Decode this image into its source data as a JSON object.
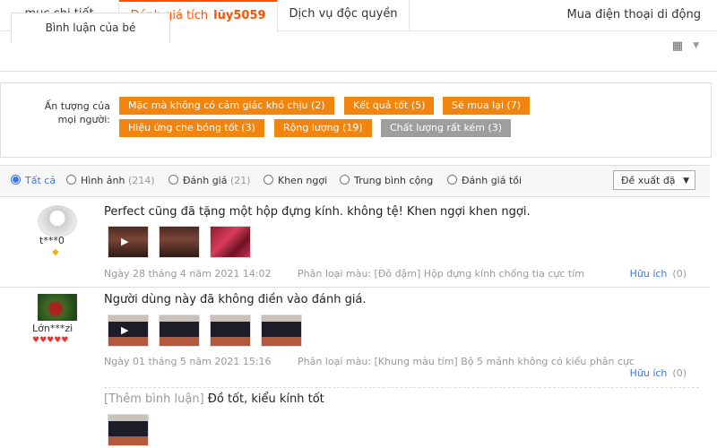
{
  "topbar": {
    "tabs": [
      {
        "label": "mục chi tiết"
      },
      {
        "label": "Đánh giá tích",
        "strong": "lũy5059"
      },
      {
        "label": "Dịch vụ độc quyền"
      }
    ],
    "right_link": "Mua điện thoại di động"
  },
  "subtab": {
    "label": "Bình luận của bé"
  },
  "impressions": {
    "label_line1": "Ấn tượng của",
    "label_line2": "mọi người:",
    "tags": [
      {
        "label": "Mặc mà không có cảm giác khó chịu (2)"
      },
      {
        "label": "Kết quả tốt (5)"
      },
      {
        "label": "Sẽ mua lại (7)"
      },
      {
        "label": "Hiệu ứng che bóng tốt (3)"
      },
      {
        "label": "Rộng lượng (19)"
      },
      {
        "label": "Chất lượng rất kém (3)"
      }
    ]
  },
  "filters": {
    "options": [
      {
        "label": "Tất cả",
        "count": "",
        "selected": true
      },
      {
        "label": "Hình ảnh",
        "count": "(214)"
      },
      {
        "label": "Đánh giá",
        "count": "(21)"
      },
      {
        "label": "Khen ngợi",
        "count": ""
      },
      {
        "label": "Trung bình cộng",
        "count": ""
      },
      {
        "label": "Đánh giá tồi",
        "count": ""
      }
    ],
    "sort_label": "Đề xuất đặ"
  },
  "reviews": [
    {
      "user": "t***0",
      "content": "Perfect cũng đã tặng một hộp đựng kính. không tệ! Khen ngợi khen ngợi.",
      "date": "Ngày 28 tháng 4 năm 2021 14:02",
      "variant": "Phân loại màu: [Đô đậm] Hộp đựng kính chống tia cực tím",
      "useful_label": "Hữu ích",
      "useful_count": "(0)"
    },
    {
      "user": "Lớn***zi",
      "content": "Người dùng này đã không điền vào đánh giá.",
      "date": "Ngày 01 tháng 5 năm 2021 15:16",
      "variant": "Phân loại màu: [Khung màu tím] Bộ 5 mảnh không có kiểu phân cực",
      "useful_label": "Hữu ích",
      "useful_count": "(0)",
      "append_prefix": "[Thêm bình luận]",
      "append_text": "Đồ tốt, kiểu kính tốt"
    }
  ],
  "colors": {
    "accent": "#ff5000",
    "tag": "#f2850f",
    "tag_gray": "#9e9e9e",
    "link": "#3c77e0"
  }
}
